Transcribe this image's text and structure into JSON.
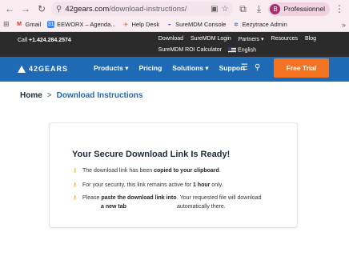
{
  "browser": {
    "url_host": "42gears.com",
    "url_path": "/download-instructions/",
    "profile_initial": "B",
    "profile_name": "Professionnel"
  },
  "bookmarks": [
    {
      "label": "Gmail",
      "icon": "gmail-icon",
      "color": "#d93025"
    },
    {
      "label": "EEWORX – Agenda...",
      "icon": "calendar-icon",
      "color": "#4285f4"
    },
    {
      "label": "Help Desk",
      "icon": "helpdesk-icon",
      "color": "#e05a2b"
    },
    {
      "label": "SureMDM Console",
      "icon": "suremdm-icon",
      "color": "#2a6bd1"
    },
    {
      "label": "Eezytrace Admin",
      "icon": "gear-icon",
      "color": "#1f6ab5"
    }
  ],
  "topbar": {
    "call_prefix": "Call ",
    "call_number": "+1.424.284.2574",
    "links_row1": [
      "Download",
      "SureMDM Login",
      "Partners ▾",
      "Resources",
      "Blog"
    ],
    "links_row2": [
      "SureMDM ROI Calculator",
      "English"
    ]
  },
  "nav": {
    "logo_text": "42GEARS",
    "items": [
      "Products ▾",
      "Pricing",
      "Solutions ▾",
      "Support"
    ],
    "cta": "Free Trial"
  },
  "breadcrumb": {
    "home": "Home",
    "separator": ">",
    "current": "Download Instructions"
  },
  "card": {
    "title": "Your Secure Download Link Is Ready!",
    "line1_a": "The download link has been ",
    "line1_b": "copied to your clipboard",
    "line1_c": ".",
    "line2_a": "For your security, this link remains active for ",
    "line2_b": "1 hour",
    "line2_c": " only.",
    "line3_a": "Please ",
    "line3_b": "paste the download link into",
    "line3_c": ". Your requested file will download",
    "line3_d": "a new tab",
    "line3_e": "automatically there."
  },
  "colors": {
    "brand_blue": "#1f6ab5",
    "cta_orange": "#f47320",
    "topbar_dark": "#2b2b2b"
  }
}
